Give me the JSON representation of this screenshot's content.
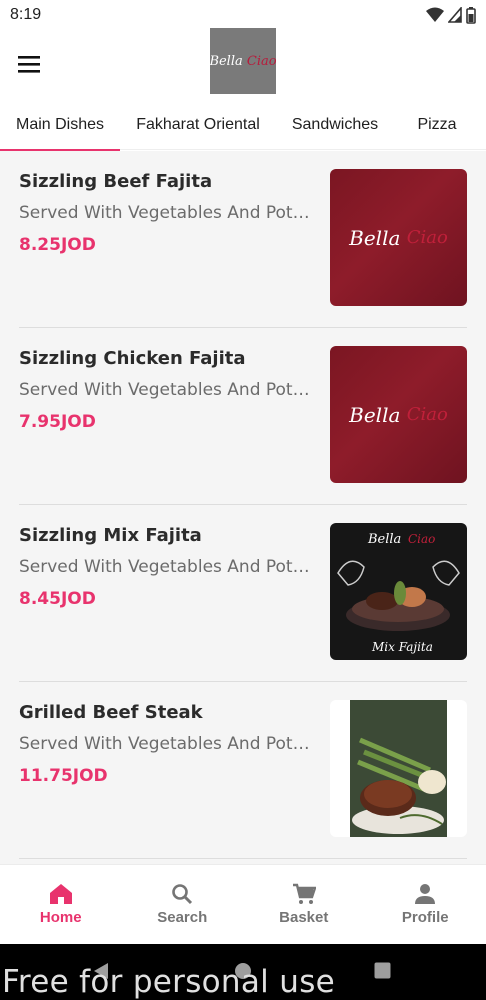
{
  "status_bar": {
    "time": "8:19"
  },
  "header": {
    "logo_text": "Bella",
    "logo_accent": "Ciao"
  },
  "tabs": [
    {
      "label": "Main Dishes",
      "active": true
    },
    {
      "label": "Fakharat Oriental",
      "active": false
    },
    {
      "label": "Sandwiches",
      "active": false
    },
    {
      "label": "Pizza",
      "active": false
    }
  ],
  "items": [
    {
      "name": "Sizzling Beef Fajita",
      "description": "Served With Vegetables And Potatoes",
      "price": "8.25JOD",
      "image_icon": "bella-ciao-logo-image"
    },
    {
      "name": "Sizzling Chicken Fajita",
      "description": "Served With Vegetables And Potatoes",
      "price": "7.95JOD",
      "image_icon": "bella-ciao-logo-image"
    },
    {
      "name": "Sizzling Mix Fajita",
      "description": "Served With Vegetables And Potatoes",
      "price": "8.45JOD",
      "image_icon": "mix-fajita-photo",
      "image_caption": "Mix Fajita"
    },
    {
      "name": "Grilled Beef Steak",
      "description": "Served With Vegetables And Potatoes",
      "price": "11.75JOD",
      "image_icon": "beef-steak-photo"
    }
  ],
  "bottom_nav": [
    {
      "label": "Home",
      "icon": "home-icon",
      "active": true
    },
    {
      "label": "Search",
      "icon": "search-icon",
      "active": false
    },
    {
      "label": "Basket",
      "icon": "cart-icon",
      "active": false
    },
    {
      "label": "Profile",
      "icon": "person-icon",
      "active": false
    }
  ],
  "watermark": "Free for personal use",
  "colors": {
    "accent": "#e8336d",
    "logo_bg": "#7b1622",
    "list_bg": "#f5f5f5"
  }
}
